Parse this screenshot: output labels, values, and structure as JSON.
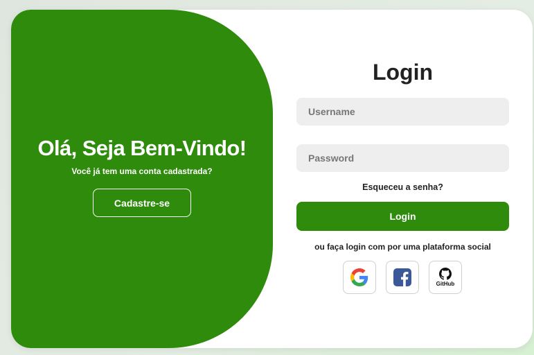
{
  "welcome": {
    "title": "Olá, Seja Bem-Vindo!",
    "subtitle": "Você já tem uma conta cadastrada?",
    "register_label": "Cadastre-se"
  },
  "login": {
    "title": "Login",
    "username_placeholder": "Username",
    "password_placeholder": "Password",
    "forgot_label": "Esqueceu a senha?",
    "submit_label": "Login",
    "social_text": "ou faça login com por uma plataforma social",
    "social": [
      {
        "name": "Google",
        "icon": "google-icon"
      },
      {
        "name": "Facebook",
        "icon": "facebook-icon"
      },
      {
        "name": "GitHub",
        "icon": "github-icon",
        "label": "GitHub"
      }
    ]
  },
  "colors": {
    "accent": "#2e8b0c",
    "input_bg": "#eeeeee",
    "card_bg": "#ffffff"
  }
}
